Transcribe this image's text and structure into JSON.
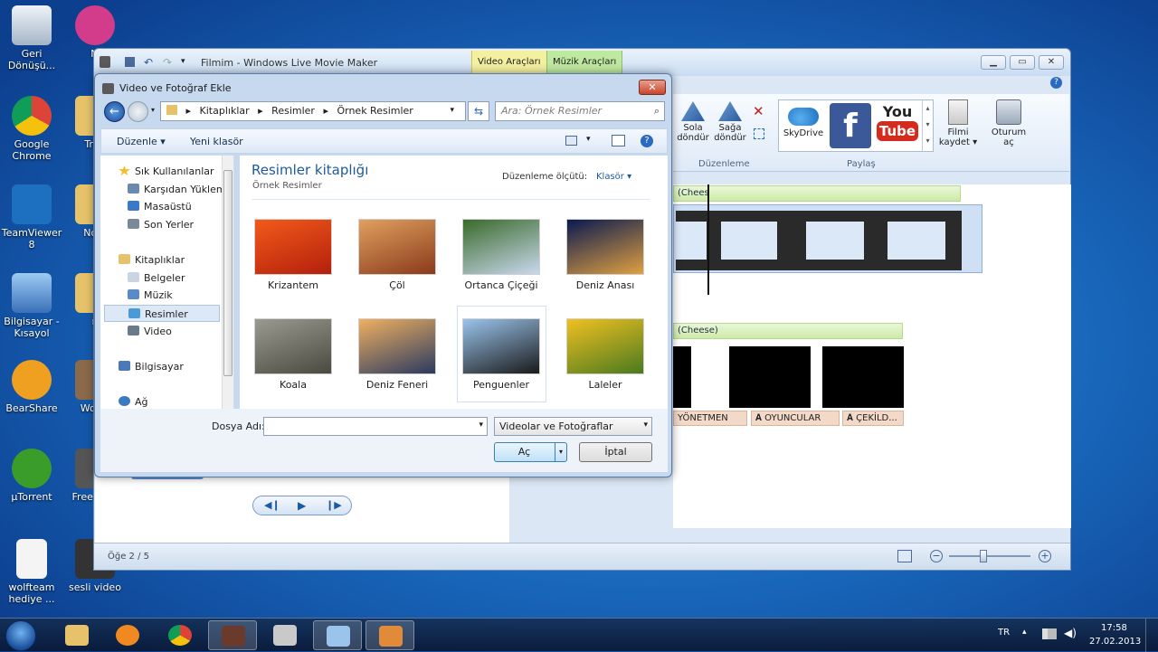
{
  "desktop": {
    "icons": [
      {
        "label": "Geri Dönüşü...",
        "color": "#c7d3df"
      },
      {
        "label": "M",
        "color": "#d23c8a"
      },
      {
        "label": "Google Chrome",
        "color": "#e4b520"
      },
      {
        "label": "Tran",
        "color": "#e6c36a"
      },
      {
        "label": "TeamViewer 8",
        "color": "#1d6fbf"
      },
      {
        "label": "No S",
        "color": "#e6c36a"
      },
      {
        "label": "Bilgisayar - Kısayol",
        "color": "#6b9fd8"
      },
      {
        "label": "n",
        "color": "#e6c36a"
      },
      {
        "label": "BearShare",
        "color": "#f0a020"
      },
      {
        "label": "Wo Tu",
        "color": "#8a6a4a"
      },
      {
        "label": "µTorrent",
        "color": "#3a9d2a"
      },
      {
        "label": "Free Vide",
        "color": "#555"
      },
      {
        "label": "wolfteam hediye ...",
        "color": "#f4f4f4"
      },
      {
        "label": "sesli video",
        "color": "#333"
      }
    ]
  },
  "moviemaker": {
    "title": "Filmim - Windows Live Movie Maker",
    "context_tabs": [
      "Video Araçları",
      "Müzik Araçları"
    ],
    "ribbon": {
      "rotate_left": "Sola döndür",
      "rotate_right": "Sağa döndür",
      "group_edit": "Düzenleme",
      "skydrive": "SkyDrive",
      "youtube_top": "You",
      "youtube_bottom": "Tube",
      "group_share": "Paylaş",
      "save_movie": "Filmi kaydet",
      "signin": "Oturum aç"
    },
    "storyboard": {
      "music1": "(Chees",
      "music2": "(Cheese)",
      "captions": [
        "YÖNETMEN",
        "OYUNCULAR",
        "ÇEKİLD..."
      ]
    },
    "status": "Öğe 2 / 5"
  },
  "dialog": {
    "title": "Video ve Fotoğraf Ekle",
    "path": [
      "Kitaplıklar",
      "Resimler",
      "Örnek Resimler"
    ],
    "search_placeholder": "Ara: Örnek Resimler",
    "toolbar": {
      "organize": "Düzenle",
      "new_folder": "Yeni klasör"
    },
    "nav": {
      "favorites": "Sık Kullanılanlar",
      "downloads": "Karşıdan Yüklem",
      "desktop": "Masaüstü",
      "recent": "Son Yerler",
      "libraries": "Kitaplıklar",
      "documents": "Belgeler",
      "music": "Müzik",
      "pictures": "Resimler",
      "video": "Video",
      "computer": "Bilgisayar",
      "network": "Ağ"
    },
    "library_title": "Resimler kitaplığı",
    "library_sub": "Örnek Resimler",
    "arrange_label": "Düzenleme ölçütü:",
    "arrange_value": "Klasör",
    "thumbs": [
      {
        "label": "Krizantem",
        "c1": "#f25a1a",
        "c2": "#b3200c"
      },
      {
        "label": "Çöl",
        "c1": "#e0a060",
        "c2": "#8a3a1a"
      },
      {
        "label": "Ortanca Çiçeği",
        "c1": "#3a6a2a",
        "c2": "#c9d8ee"
      },
      {
        "label": "Deniz Anası",
        "c1": "#0a1a50",
        "c2": "#e0a040"
      },
      {
        "label": "Koala",
        "c1": "#9a9a90",
        "c2": "#4a4a40"
      },
      {
        "label": "Deniz Feneri",
        "c1": "#f0b060",
        "c2": "#2a3a60"
      },
      {
        "label": "Penguenler",
        "c1": "#9ac4ec",
        "c2": "#1a1a1a"
      },
      {
        "label": "Laleler",
        "c1": "#f0c020",
        "c2": "#4a7a20"
      }
    ],
    "filename_label": "Dosya Adı:",
    "filename_value": "",
    "filetype": "Videolar ve Fotoğraflar",
    "open": "Aç",
    "cancel": "İptal"
  },
  "taskbar": {
    "lang": "TR",
    "time": "17:58",
    "date": "27.02.2013"
  }
}
